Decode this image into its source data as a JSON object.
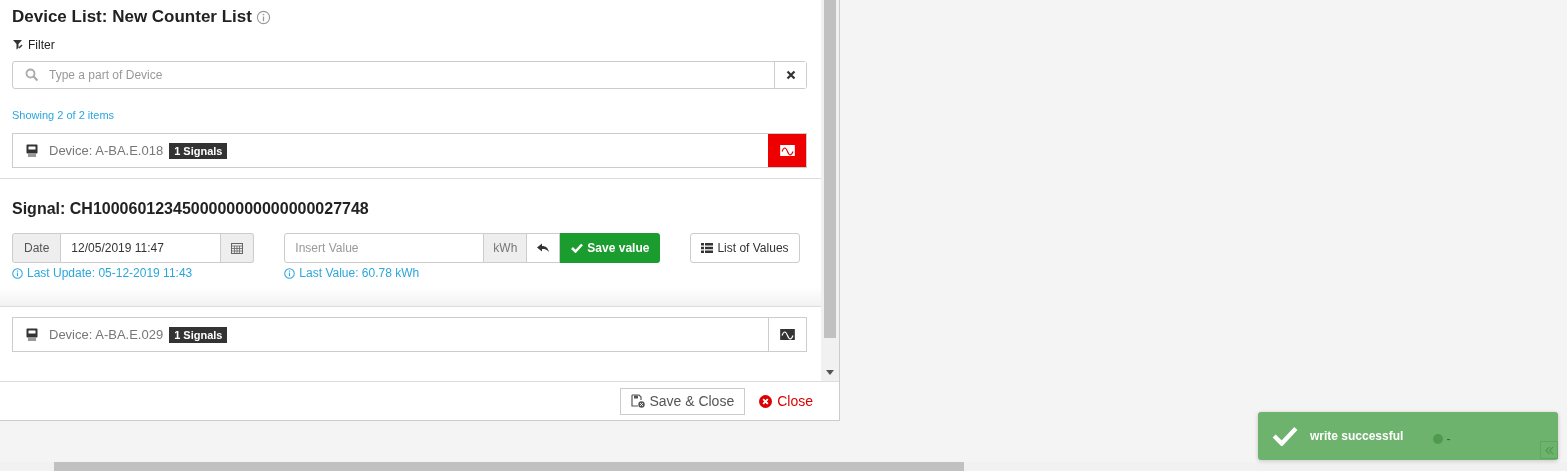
{
  "dialog": {
    "title": "Device List: New Counter List",
    "filter_label": "Filter",
    "search": {
      "placeholder": "Type a part of Device"
    },
    "count_text": "Showing 2 of 2 items"
  },
  "devices": [
    {
      "name": "Device: A-BA.E.018",
      "badge": "1 Signals",
      "expanded": true,
      "signal": {
        "title": "Signal: CH1000601234500000000000000027748",
        "date_label": "Date",
        "date_value": "12/05/2019 11:47",
        "last_update": "Last Update: 05-12-2019 11:43",
        "value_placeholder": "Insert Value",
        "unit": "kWh",
        "save_label": "Save value",
        "last_value": "Last Value: 60.78 kWh",
        "list_label": "List of Values"
      }
    },
    {
      "name": "Device: A-BA.E.029",
      "badge": "1 Signals",
      "expanded": false
    }
  ],
  "footer": {
    "save_close": "Save & Close",
    "close": "Close"
  },
  "toast": {
    "message": "write successful",
    "detail": "-"
  }
}
